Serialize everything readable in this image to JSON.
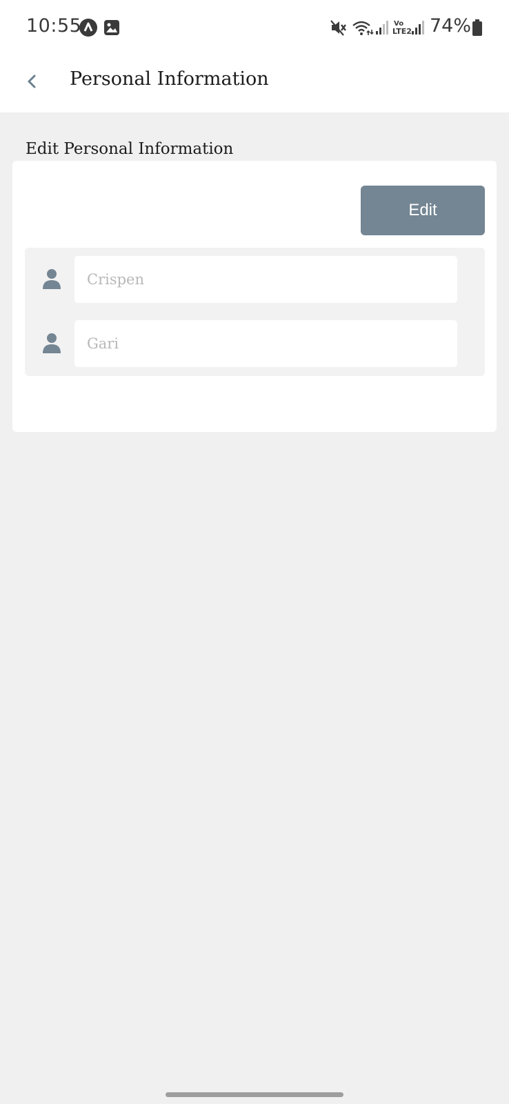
{
  "status_bar": {
    "time": "10:55",
    "battery": "74%",
    "icons": [
      "app-notification-icon",
      "gallery-icon",
      "mute-icon",
      "wifi-icon",
      "signal-icon",
      "volte-icon",
      "signal-icon",
      "battery-icon"
    ],
    "volte_label": "Vo LTE2"
  },
  "app_bar": {
    "title": "Personal Information",
    "back_icon": "chevron-left-icon"
  },
  "section": {
    "title": "Edit Personal Information"
  },
  "card": {
    "edit_label": "Edit",
    "fields": [
      {
        "icon": "person-icon",
        "placeholder": "Crispen"
      },
      {
        "icon": "person-icon",
        "placeholder": "Gari"
      }
    ]
  },
  "colors": {
    "accent": "#748593",
    "background": "#f0f0f1",
    "card": "#ffffff",
    "placeholder": "#b8b8b8"
  }
}
